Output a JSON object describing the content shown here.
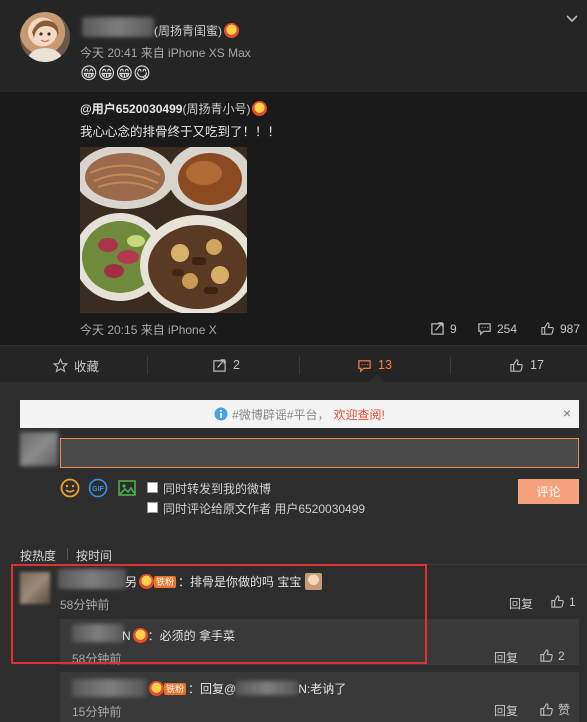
{
  "post": {
    "author_suffix": "(周扬青闺蜜)",
    "meta": "今天 20:41 来自 iPhone XS Max",
    "emojis": "😁😁😁😋"
  },
  "repost": {
    "user": "@用户6520030499",
    "user_suffix": "(周扬青小号)",
    "text": "我心心念的排骨终于又吃到了！！！",
    "meta": "今天 20:15 来自 iPhone X",
    "stats": {
      "forward": "9",
      "comment": "254",
      "like": "987"
    }
  },
  "actions": {
    "collect": "收藏",
    "forward": "2",
    "comment": "13",
    "like": "17"
  },
  "notice": {
    "tag": "#微博辟谣#平台，",
    "highlight": "欢迎查阅!",
    "close": "×"
  },
  "composer": {
    "input_value": "",
    "option_forward": "同时转发到我的微博",
    "option_comment_author": "同时评论给原文作者 用户6520030499",
    "submit": "评论"
  },
  "sort": {
    "hot": "按热度",
    "time": "按时间"
  },
  "comments": [
    {
      "name_tail": "另",
      "badge": "铁粉",
      "text": "：排骨是你做的吗 宝宝",
      "time": "58分钟前",
      "reply": "回复",
      "likes": "1"
    }
  ],
  "sub_comments": [
    {
      "name_tail": "N",
      "text": "：必须的 拿手菜",
      "time": "58分钟前",
      "reply": "回复",
      "likes": "2"
    },
    {
      "badge": "铁粉",
      "text_prefix": "：回复@",
      "text_suffix": "N:老讷了",
      "time": "15分钟前",
      "reply": "回复",
      "likes": "赞"
    }
  ]
}
